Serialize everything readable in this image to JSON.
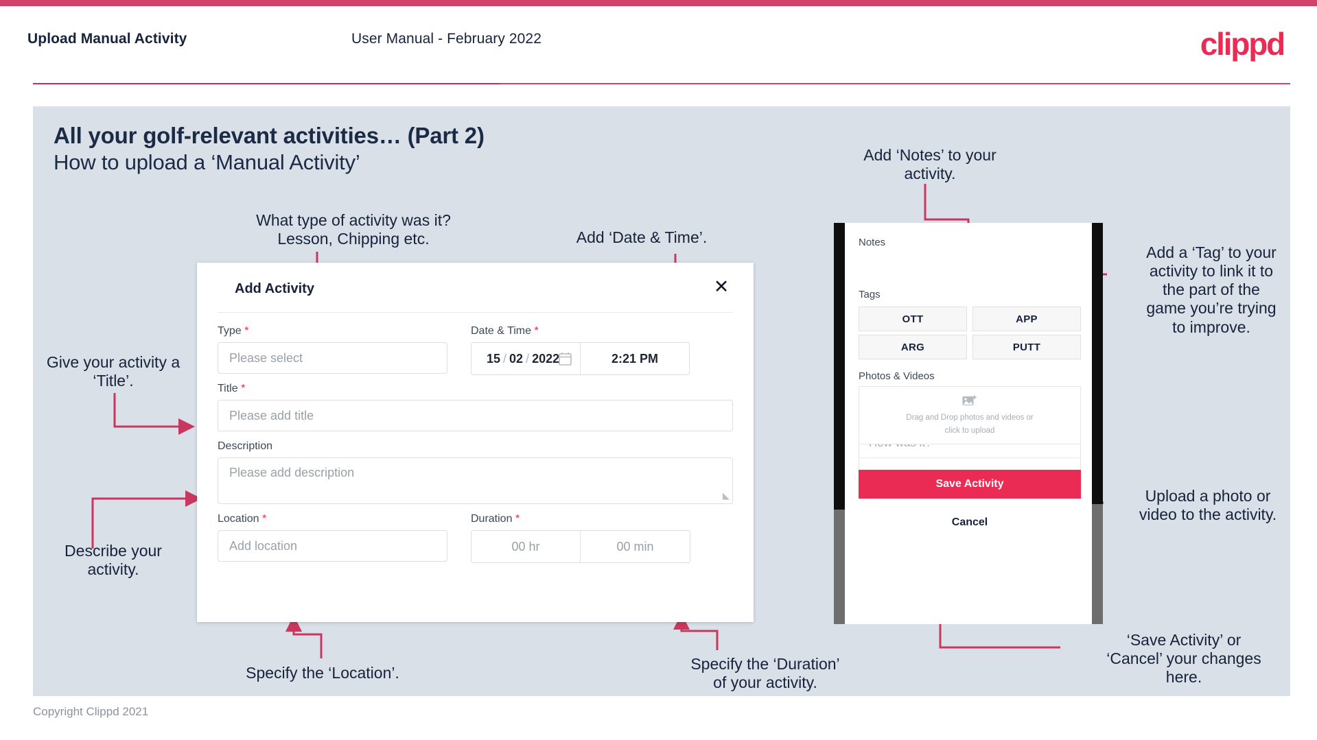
{
  "header": {
    "left_title": "Upload Manual Activity",
    "center_title": "User Manual - February 2022",
    "logo": "clippd"
  },
  "slide": {
    "title_line1": "All your golf-relevant activities… (Part 2)",
    "title_line2": "How to upload a ‘Manual Activity’"
  },
  "annotations": {
    "type": "What type of activity was it?\nLesson, Chipping etc.",
    "datetime": "Add ‘Date & Time’.",
    "title": "Give your activity a\n‘Title’.",
    "describe": "Describe your\nactivity.",
    "location": "Specify the ‘Location’.",
    "duration": "Specify the ‘Duration’\nof your activity.",
    "notes": "Add ‘Notes’ to your\nactivity.",
    "tags": "Add a ‘Tag’ to your\nactivity to link it to\nthe part of the\ngame you’re trying\nto improve.",
    "upload": "Upload a photo or\nvideo to the activity.",
    "save_cancel": "‘Save Activity’ or\n‘Cancel’ your changes\nhere."
  },
  "modal": {
    "title": "Add Activity",
    "close_icon": "close-icon",
    "fields": {
      "type": {
        "label": "Type",
        "required": "*",
        "placeholder": "Please select"
      },
      "datetime": {
        "label": "Date & Time",
        "required": "*",
        "day": "15",
        "month": "02",
        "year": "2022",
        "sep": "/",
        "time": "2:21 PM",
        "calendar_icon": "calendar-icon"
      },
      "title": {
        "label": "Title",
        "required": "*",
        "placeholder": "Please add title"
      },
      "description": {
        "label": "Description",
        "required": "",
        "placeholder": "Please add description"
      },
      "location": {
        "label": "Location",
        "required": "*",
        "placeholder": "Add location"
      },
      "duration": {
        "label": "Duration",
        "required": "*",
        "hours": "00 hr",
        "minutes": "00 min"
      }
    }
  },
  "phone": {
    "notes_label": "Notes",
    "notes_placeholder": "How was it?",
    "tags_label": "Tags",
    "tags": [
      "OTT",
      "APP",
      "ARG",
      "PUTT"
    ],
    "photos_label": "Photos & Videos",
    "upload_icon": "add-image-icon",
    "upload_text_line1": "Drag and Drop photos and videos or",
    "upload_text_line2": "click to upload",
    "save_label": "Save Activity",
    "cancel_label": "Cancel"
  },
  "footer": {
    "copyright": "Copyright Clippd 2021"
  },
  "colors": {
    "brand_pink": "#ea2b53",
    "accent_rule": "#d2436a",
    "slide_bg": "#d9e0e8",
    "text_dark": "#17223b"
  }
}
